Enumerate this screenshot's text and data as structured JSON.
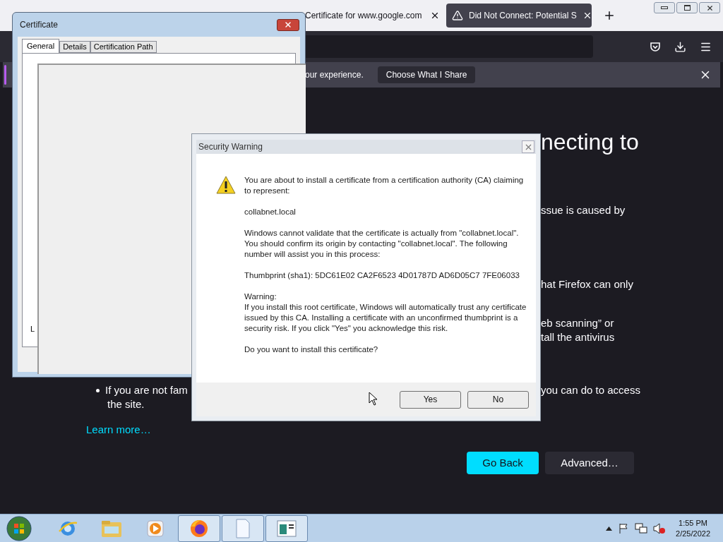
{
  "browser": {
    "tabs": [
      {
        "title": "Certificate for www.google.com",
        "selected": false
      },
      {
        "title": "Did Not Connect: Potential S",
        "selected": true
      }
    ],
    "notification": {
      "text": "our experience.",
      "button": "Choose What I Share"
    }
  },
  "page": {
    "heading": "necting to",
    "right_fragments": [
      "ssue is caused by",
      "hat Firefox can only",
      "eb scanning” or",
      "tall the antivirus",
      "you can do to access"
    ],
    "bullet_start": "If you are not fam",
    "bullet_end": "the site.",
    "learn_more": "Learn more…",
    "buttons": [
      {
        "label": "Go Back",
        "kind": "primary"
      },
      {
        "label": "Advanced…",
        "kind": "secondary"
      }
    ]
  },
  "certificate_window": {
    "title": "Certificate",
    "tabs": [
      {
        "label": "General",
        "selected": true
      },
      {
        "label": "Details",
        "selected": false
      },
      {
        "label": "Certification Path",
        "selected": false
      }
    ],
    "cut_label": "L"
  },
  "security_dialog": {
    "title": "Security Warning",
    "paragraphs": [
      [
        "You are about to install a certificate from a certification authority (CA) claiming to represent:"
      ],
      [
        "collabnet.local"
      ],
      [
        "Windows cannot validate that the certificate is actually from \"collabnet.local\". You should confirm its origin by contacting \"collabnet.local\". The following number will assist you in this process:"
      ],
      [
        "Thumbprint (sha1): 5DC61E02 CA2F6523 4D01787D AD6D05C7 7FE06033"
      ],
      [
        "Warning:",
        "If you install this root certificate, Windows will automatically trust any certificate issued by this CA. Installing a certificate with an unconfirmed thumbprint is a security risk. If you click \"Yes\" you acknowledge this risk."
      ],
      [
        "Do you want to install this certificate?"
      ]
    ],
    "buttons": [
      "Yes",
      "No"
    ]
  },
  "taskbar": {
    "apps": [
      {
        "kind": "ie",
        "open": false
      },
      {
        "kind": "explorer",
        "open": false
      },
      {
        "kind": "media",
        "open": false
      },
      {
        "kind": "firefox",
        "open": true
      },
      {
        "kind": "document",
        "open": true
      },
      {
        "kind": "app",
        "open": true
      }
    ],
    "time": "1:55 PM",
    "date": "2/25/2022"
  }
}
